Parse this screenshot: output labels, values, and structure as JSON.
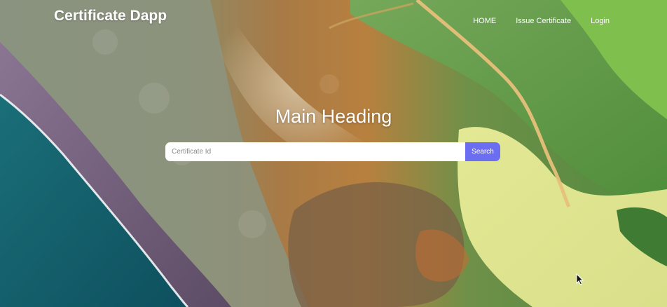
{
  "header": {
    "brand": "Certificate Dapp",
    "nav": [
      {
        "label": "HOME"
      },
      {
        "label": "Issue Certificate"
      },
      {
        "label": "Login"
      }
    ]
  },
  "hero": {
    "title": "Main Heading"
  },
  "search": {
    "placeholder": "Certificate Id",
    "value": "",
    "button_label": "Search"
  },
  "colors": {
    "accent": "#6b6ef0",
    "text": "#ffffff",
    "ocean": "#11606e",
    "shore_purple": "#7b6a86",
    "delta_green": "#5f8f45",
    "delta_orange": "#b9803d",
    "lagoon_yellow": "#e9efa0"
  }
}
